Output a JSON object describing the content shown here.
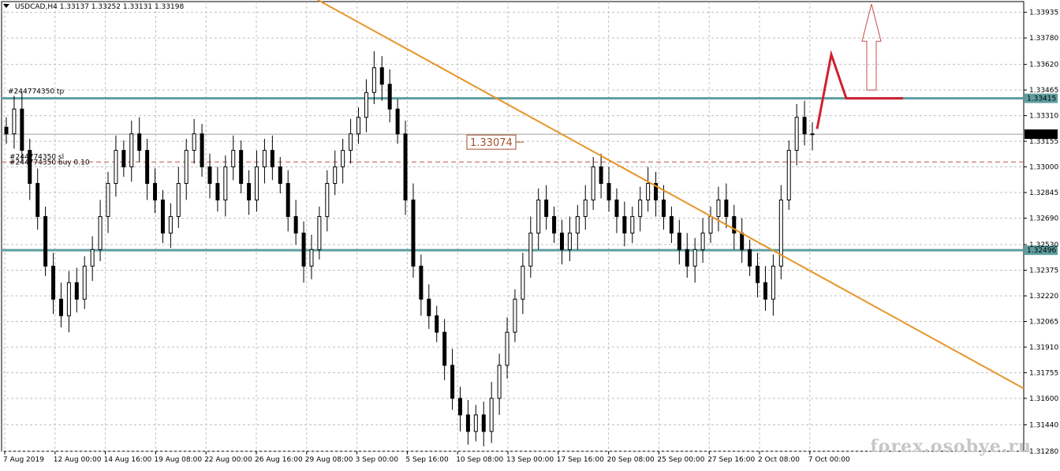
{
  "header": {
    "symbol": "USDCAD,H4",
    "ohlc": "1.33137 1.33252 1.33131 1.33198"
  },
  "order_labels": {
    "tp": "#244774350 tp",
    "order_a": "#244774350 sl",
    "order_b": "#244774350 buy 0.10"
  },
  "price_box": "1.33074",
  "watermark": "forex.osobye.ru",
  "colors": {
    "grid": "#c0c0c0",
    "candle": "#000000",
    "trendline": "#e6952a",
    "level": "#5f9ea0",
    "level_label_bg": "#5f9ea0",
    "bid_line": "#a0a0a0",
    "bid_label_bg": "#000000",
    "order_line": "#c0504d",
    "forecast": "#d0202e",
    "arrow": "#c0504d"
  },
  "chart_data": {
    "type": "candlestick",
    "symbol": "USDCAD",
    "timeframe": "H4",
    "ylim": [
      1.3128,
      1.34
    ],
    "y_ticks": [
      "1.33935",
      "1.33780",
      "1.33620",
      "1.33465",
      "1.33310",
      "1.33155",
      "1.33000",
      "1.32845",
      "1.32690",
      "1.32530",
      "1.32375",
      "1.32220",
      "1.32065",
      "1.31910",
      "1.31755",
      "1.31600",
      "1.31440",
      "1.31280"
    ],
    "x_labels": [
      "7 Aug 2019",
      "12 Aug 00:00",
      "14 Aug 16:00",
      "19 Aug 08:00",
      "22 Aug 00:00",
      "26 Aug 16:00",
      "29 Aug 08:00",
      "3 Sep 00:00",
      "5 Sep 16:00",
      "10 Sep 08:00",
      "13 Sep 00:00",
      "17 Sep 16:00",
      "20 Sep 08:00",
      "25 Sep 00:00",
      "27 Sep 16:00",
      "2 Oct 08:00",
      "7 Oct 00:00"
    ],
    "levels": [
      {
        "label": "1.33415",
        "price": 1.33415
      },
      {
        "label": "1.32496",
        "price": 1.32496
      }
    ],
    "bid": {
      "label": "1.33198",
      "price": 1.33198
    },
    "order_price": 1.3303,
    "closes": [
      1.332,
      1.3335,
      1.331,
      1.329,
      1.327,
      1.324,
      1.322,
      1.321,
      1.323,
      1.322,
      1.324,
      1.325,
      1.327,
      1.329,
      1.331,
      1.33,
      1.332,
      1.331,
      1.329,
      1.328,
      1.326,
      1.327,
      1.329,
      1.331,
      1.332,
      1.33,
      1.329,
      1.328,
      1.33,
      1.331,
      1.329,
      1.328,
      1.33,
      1.331,
      1.33,
      1.329,
      1.327,
      1.326,
      1.324,
      1.325,
      1.327,
      1.329,
      1.33,
      1.331,
      1.332,
      1.333,
      1.3345,
      1.336,
      1.335,
      1.3335,
      1.332,
      1.328,
      1.324,
      1.322,
      1.321,
      1.32,
      1.318,
      1.316,
      1.315,
      1.314,
      1.315,
      1.314,
      1.316,
      1.318,
      1.32,
      1.322,
      1.324,
      1.326,
      1.328,
      1.327,
      1.326,
      1.325,
      1.326,
      1.327,
      1.328,
      1.33,
      1.329,
      1.328,
      1.327,
      1.326,
      1.327,
      1.328,
      1.329,
      1.328,
      1.327,
      1.326,
      1.325,
      1.324,
      1.325,
      1.326,
      1.327,
      1.328,
      1.327,
      1.326,
      1.325,
      1.324,
      1.323,
      1.322,
      1.324,
      1.328,
      1.331,
      1.333,
      1.332,
      1.332
    ],
    "trendline": {
      "from": {
        "x_label": "29 Aug 08:00",
        "price": 1.3401
      },
      "to": {
        "x_label_after": "7 Oct 00:00",
        "price": 1.3166
      }
    },
    "forecast_path": [
      1.3323,
      1.3368,
      1.33415,
      1.33415
    ]
  }
}
